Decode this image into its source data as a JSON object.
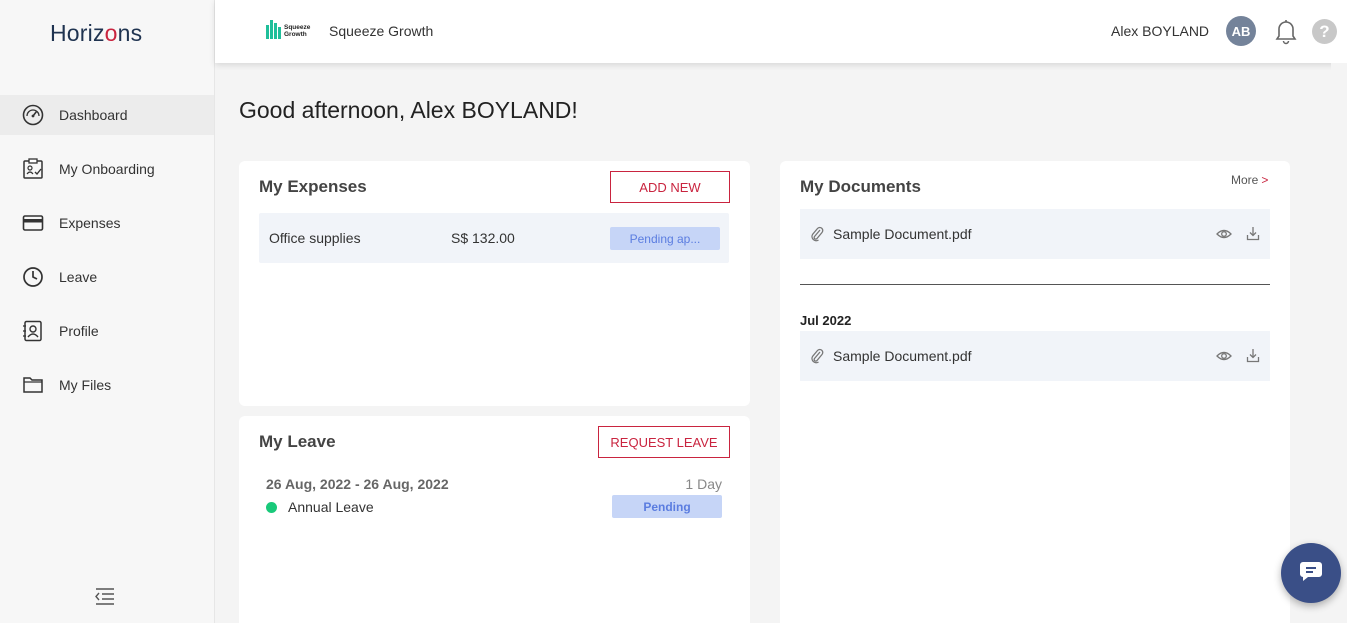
{
  "app": {
    "logo_prefix": "Horiz",
    "logo_o": "o",
    "logo_suffix": "ns",
    "accent": "#c9243f",
    "navy": "#1f3350"
  },
  "sidebar": {
    "items": [
      {
        "label": "Dashboard",
        "icon": "dashboard-gauge-icon",
        "active": true
      },
      {
        "label": "My Onboarding",
        "icon": "onboarding-checklist-icon"
      },
      {
        "label": "Expenses",
        "icon": "credit-card-icon"
      },
      {
        "label": "Leave",
        "icon": "clock-icon"
      },
      {
        "label": "Profile",
        "icon": "profile-id-icon"
      },
      {
        "label": "My Files",
        "icon": "folder-icon"
      }
    ],
    "collapse_icon": "collapse-menu-icon"
  },
  "topbar": {
    "company_name": "Squeeze Growth",
    "company_logo_text_1": "Squeeze",
    "company_logo_text_2": "Growth",
    "user_name": "Alex BOYLAND",
    "avatar_initials": "AB",
    "help_glyph": "?"
  },
  "greeting": "Good afternoon, Alex BOYLAND!",
  "expenses": {
    "title": "My Expenses",
    "add_button": "ADD NEW",
    "rows": [
      {
        "description": "Office supplies",
        "amount": "S$ 132.00",
        "status": "Pending ap..."
      }
    ]
  },
  "leave": {
    "title": "My Leave",
    "request_button": "REQUEST LEAVE",
    "entries": [
      {
        "dates": "26 Aug, 2022 - 26 Aug, 2022",
        "days": "1 Day",
        "type": "Annual Leave",
        "status": "Pending"
      }
    ]
  },
  "documents": {
    "title": "My Documents",
    "more_label": "More",
    "more_chevron": ">",
    "recent": [
      {
        "name": "Sample Document.pdf"
      }
    ],
    "groups": [
      {
        "month": "Jul 2022",
        "files": [
          {
            "name": "Sample Document.pdf"
          }
        ]
      }
    ]
  }
}
